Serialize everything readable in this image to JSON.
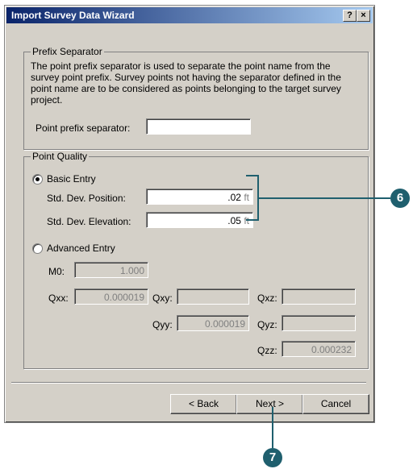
{
  "window": {
    "title": "Import Survey Data Wizard",
    "help_btn": "?",
    "close_btn": "×"
  },
  "prefix": {
    "legend": "Prefix Separator",
    "description": "The point prefix separator is used to separate the point name from the survey point prefix. Survey points not having the separator defined in the point name are to be considered as points belonging to the target survey project.",
    "separator_label": "Point prefix separator:",
    "separator_value": ""
  },
  "quality": {
    "legend": "Point Quality",
    "basic_label": "Basic Entry",
    "basic_selected": true,
    "pos_label": "Std. Dev. Position:",
    "pos_value": ".02",
    "pos_unit": "ft",
    "elev_label": "Std. Dev. Elevation:",
    "elev_value": ".05",
    "elev_unit": "ft",
    "advanced_label": "Advanced Entry",
    "m0_label": "M0:",
    "m0_value": "1.000",
    "qxx_label": "Qxx:",
    "qxx_value": "0.000019",
    "qxy_label": "Qxy:",
    "qxy_value": "",
    "qxz_label": "Qxz:",
    "qxz_value": "",
    "qyy_label": "Qyy:",
    "qyy_value": "0.000019",
    "qyz_label": "Qyz:",
    "qyz_value": "",
    "qzz_label": "Qzz:",
    "qzz_value": "0.000232"
  },
  "buttons": {
    "back": "< Back",
    "next": "Next >",
    "cancel": "Cancel"
  },
  "callouts": {
    "six": "6",
    "seven": "7"
  },
  "colors": {
    "title_bar": "#0a246a",
    "callout": "#1f5f6e"
  }
}
